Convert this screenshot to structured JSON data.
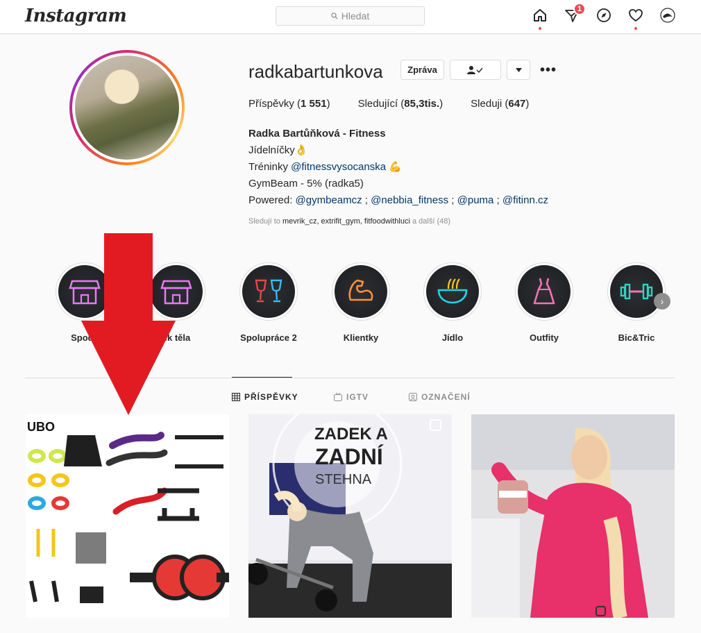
{
  "topbar": {
    "logo": "Instagram",
    "search_placeholder": "Hledat",
    "direct_badge": "1"
  },
  "profile": {
    "username": "radkabartunkova",
    "message_button": "Zpráva",
    "stats": {
      "posts_label": "Příspěvky",
      "posts_value": "1 551",
      "followers_label": "Sledující",
      "followers_value": "85,3tis.",
      "following_label": "Sleduji",
      "following_value": "647"
    },
    "bio": {
      "name": "Radka Bartůňková - Fitness",
      "line1": "Jídelníčky👌",
      "line2_prefix": "Tréninky",
      "line2_link": "@fitnessvysocanska",
      "line2_emoji": "💪",
      "line3": "GymBeam - 5% (radka5)",
      "line4_prefix": "Powered:",
      "line4_links": [
        "@gymbeamcz",
        "@nebbia_fitness",
        "@puma",
        "@fitinn.cz"
      ]
    },
    "followed_by": {
      "prefix": "Sledují to",
      "names": "mevrik_cz, extrifit_gym, fitfoodwithluci",
      "suffix": "a další (48)"
    }
  },
  "highlights": [
    {
      "label": "Spodé",
      "icon": "shop-icon",
      "color": "#d946ef"
    },
    {
      "label": "ek těla",
      "icon": "shop-icon",
      "color": "#d946ef"
    },
    {
      "label": "Spolupráce 2",
      "icon": "wine-glasses-icon",
      "color": "#38bdf8"
    },
    {
      "label": "Klientky",
      "icon": "biceps-icon",
      "color": "#fb923c"
    },
    {
      "label": "Jídlo",
      "icon": "noodle-bowl-icon",
      "color": "#22d3ee"
    },
    {
      "label": "Outfity",
      "icon": "dress-icon",
      "color": "#f472b6"
    },
    {
      "label": "Bic&Tric",
      "icon": "dumbbell-icon",
      "color": "#2dd4bf"
    }
  ],
  "tabs": [
    {
      "label": "PŘÍSPĚVKY",
      "icon": "grid-icon",
      "active": true
    },
    {
      "label": "IGTV",
      "icon": "igtv-icon",
      "active": false
    },
    {
      "label": "OZNAČENÍ",
      "icon": "tagged-icon",
      "active": false
    }
  ],
  "posts": [
    {
      "overlay_text": "UBO",
      "kind": "equipment"
    },
    {
      "overlay_line1": "ZADEK A",
      "overlay_line2": "ZADNÍ",
      "overlay_line3": "STEHNA",
      "kind": "workout"
    },
    {
      "overlay_text": "",
      "kind": "portrait"
    }
  ],
  "colors": {
    "accent_red": "#e21b23",
    "link": "#00376b",
    "badge": "#ed4956"
  }
}
